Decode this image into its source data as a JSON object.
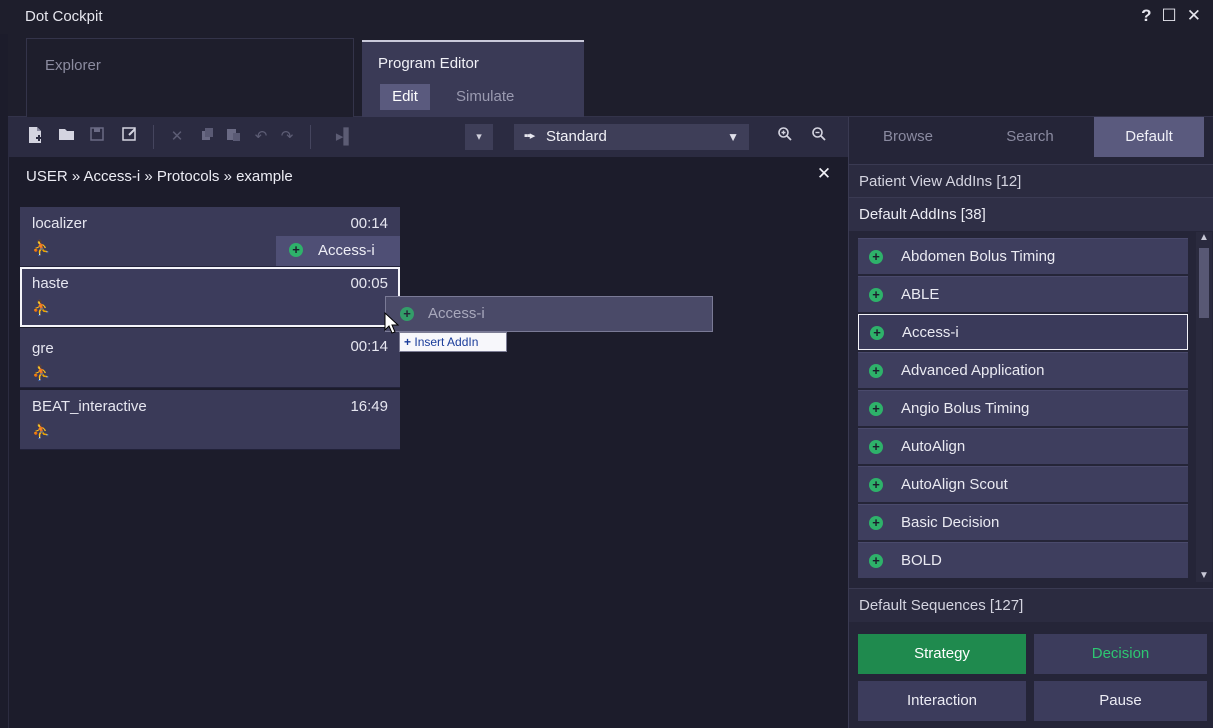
{
  "window": {
    "title": "Dot Cockpit",
    "controls": [
      "?",
      "☐",
      "✕"
    ]
  },
  "tabs": {
    "explorer": "Explorer",
    "program_editor": "Program Editor",
    "edit": "Edit",
    "simulate": "Simulate"
  },
  "toolbar": {
    "icons": [
      "new-file-icon",
      "open-folder-icon",
      "save-icon",
      "save-as-icon",
      "delete-icon",
      "copy-icon",
      "paste-icon",
      "undo-icon",
      "redo-icon",
      "run-icon",
      "zoom-in-icon",
      "zoom-out-icon"
    ],
    "dropdown_small": "▾",
    "dropdown_value": "Standard"
  },
  "breadcrumb": "USER » Access-i » Protocols » example",
  "protocols": [
    {
      "name": "localizer",
      "time": "00:14"
    },
    {
      "name": "haste",
      "time": "00:05"
    },
    {
      "name": "gre",
      "time": "00:14"
    },
    {
      "name": "BEAT_interactive",
      "time": "16:49"
    }
  ],
  "attached_addin": "Access-i",
  "drag": {
    "ghost_label": "Access-i",
    "tooltip": "Insert AddIn"
  },
  "right_panel": {
    "tabs": [
      "Browse",
      "Search",
      "Default"
    ],
    "active_tab": "Default",
    "sections": {
      "patient": "Patient View AddIns [12]",
      "default_addins": "Default AddIns [38]",
      "sequences": "Default Sequences [127]"
    },
    "addins": [
      "Abdomen Bolus Timing",
      "ABLE",
      "Access-i",
      "Advanced Application",
      "Angio Bolus Timing",
      "AutoAlign",
      "AutoAlign Scout",
      "Basic Decision",
      "BOLD"
    ],
    "selected_addin": "Access-i",
    "sequences": {
      "strategy": "Strategy",
      "decision": "Decision",
      "interaction": "Interaction",
      "pause": "Pause"
    }
  },
  "colors": {
    "accent_green": "#1f8a4e",
    "decision_text": "#2ec672",
    "plus_icon": "#2eb26a"
  }
}
